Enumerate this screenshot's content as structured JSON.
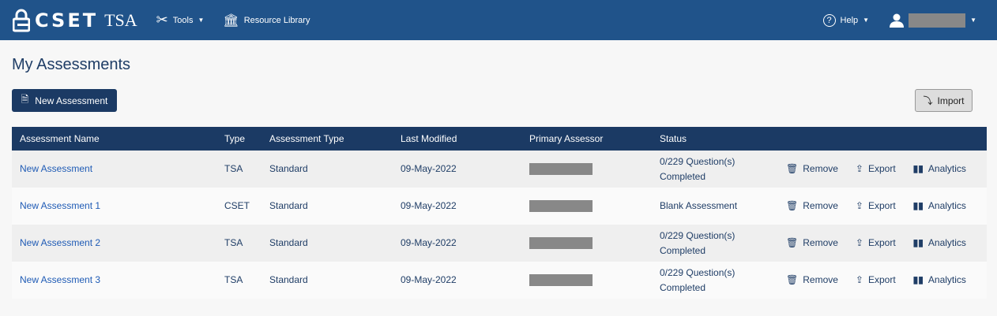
{
  "nav": {
    "logo": "CSET",
    "logo_suffix": "TSA",
    "tools": "Tools",
    "resource_library": "Resource Library",
    "help": "Help"
  },
  "page": {
    "title": "My Assessments",
    "new_button": "New Assessment",
    "import_button": "Import"
  },
  "table": {
    "headers": [
      "Assessment Name",
      "Type",
      "Assessment Type",
      "Last Modified",
      "Primary Assessor",
      "Status"
    ],
    "actions": {
      "remove": "Remove",
      "export": "Export",
      "analytics": "Analytics"
    },
    "rows": [
      {
        "name": "New Assessment",
        "type": "TSA",
        "assessment_type": "Standard",
        "modified": "09-May-2022",
        "status": "0/229 Question(s) Completed"
      },
      {
        "name": "New Assessment 1",
        "type": "CSET",
        "assessment_type": "Standard",
        "modified": "09-May-2022",
        "status": "Blank Assessment"
      },
      {
        "name": "New Assessment 2",
        "type": "TSA",
        "assessment_type": "Standard",
        "modified": "09-May-2022",
        "status": "0/229 Question(s) Completed"
      },
      {
        "name": "New Assessment 3",
        "type": "TSA",
        "assessment_type": "Standard",
        "modified": "09-May-2022",
        "status": "0/229 Question(s) Completed"
      }
    ]
  },
  "colors": {
    "nav": "#20538a",
    "header": "#1b3a64",
    "link": "#1f5bb5"
  }
}
